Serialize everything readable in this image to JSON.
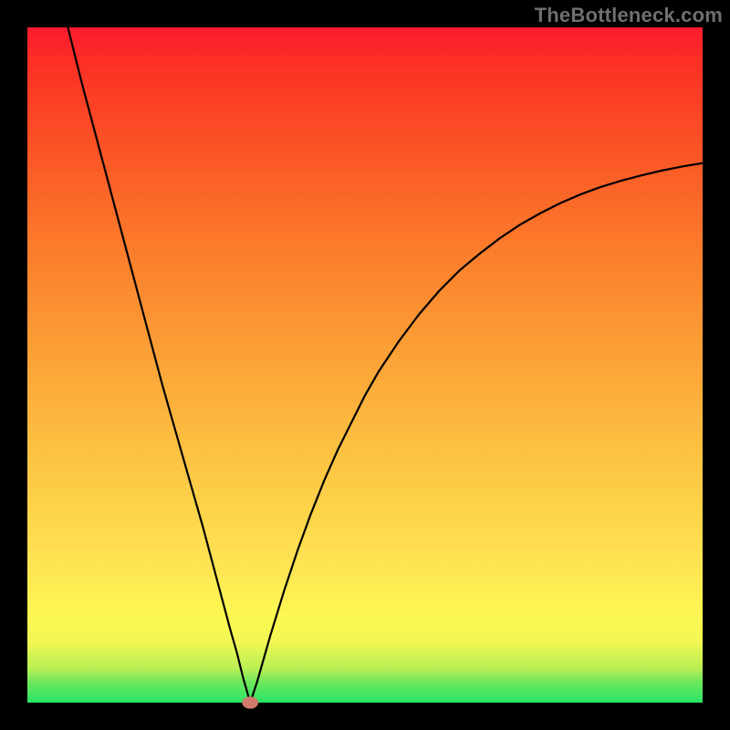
{
  "watermark": "TheBottleneck.com",
  "colors": {
    "frame": "#000000",
    "curve": "#000000",
    "marker": "#cf7a6b",
    "gradient_top": "#fd1a2e",
    "gradient_bottom": "#28e466"
  },
  "chart_data": {
    "type": "line",
    "title": "",
    "xlabel": "",
    "ylabel": "",
    "xlim": [
      0,
      100
    ],
    "ylim": [
      0,
      100
    ],
    "minimum": {
      "x": 33,
      "y": 0
    },
    "marker": {
      "x": 33,
      "y": 0,
      "rx": 1.2,
      "ry": 0.9
    },
    "curve_points": [
      {
        "x": 6,
        "y": 100
      },
      {
        "x": 8,
        "y": 92
      },
      {
        "x": 10,
        "y": 84.5
      },
      {
        "x": 12,
        "y": 77
      },
      {
        "x": 14,
        "y": 69.5
      },
      {
        "x": 16,
        "y": 62
      },
      {
        "x": 18,
        "y": 54.5
      },
      {
        "x": 20,
        "y": 47
      },
      {
        "x": 22,
        "y": 40
      },
      {
        "x": 24,
        "y": 33
      },
      {
        "x": 26,
        "y": 26
      },
      {
        "x": 28,
        "y": 18.5
      },
      {
        "x": 30,
        "y": 11
      },
      {
        "x": 31,
        "y": 7.5
      },
      {
        "x": 32,
        "y": 3.5
      },
      {
        "x": 33,
        "y": 0
      },
      {
        "x": 34,
        "y": 3
      },
      {
        "x": 35,
        "y": 6.5
      },
      {
        "x": 36,
        "y": 10
      },
      {
        "x": 38,
        "y": 16.5
      },
      {
        "x": 40,
        "y": 22.5
      },
      {
        "x": 42,
        "y": 28
      },
      {
        "x": 44,
        "y": 33
      },
      {
        "x": 46,
        "y": 37.5
      },
      {
        "x": 48,
        "y": 41.5
      },
      {
        "x": 50,
        "y": 45.5
      },
      {
        "x": 52,
        "y": 49
      },
      {
        "x": 55,
        "y": 53.5
      },
      {
        "x": 58,
        "y": 57.5
      },
      {
        "x": 61,
        "y": 61
      },
      {
        "x": 64,
        "y": 64
      },
      {
        "x": 67,
        "y": 66.5
      },
      {
        "x": 70,
        "y": 68.8
      },
      {
        "x": 73,
        "y": 70.8
      },
      {
        "x": 76,
        "y": 72.5
      },
      {
        "x": 79,
        "y": 74
      },
      {
        "x": 82,
        "y": 75.3
      },
      {
        "x": 85,
        "y": 76.4
      },
      {
        "x": 88,
        "y": 77.3
      },
      {
        "x": 91,
        "y": 78.1
      },
      {
        "x": 94,
        "y": 78.8
      },
      {
        "x": 97,
        "y": 79.4
      },
      {
        "x": 100,
        "y": 79.9
      }
    ]
  }
}
